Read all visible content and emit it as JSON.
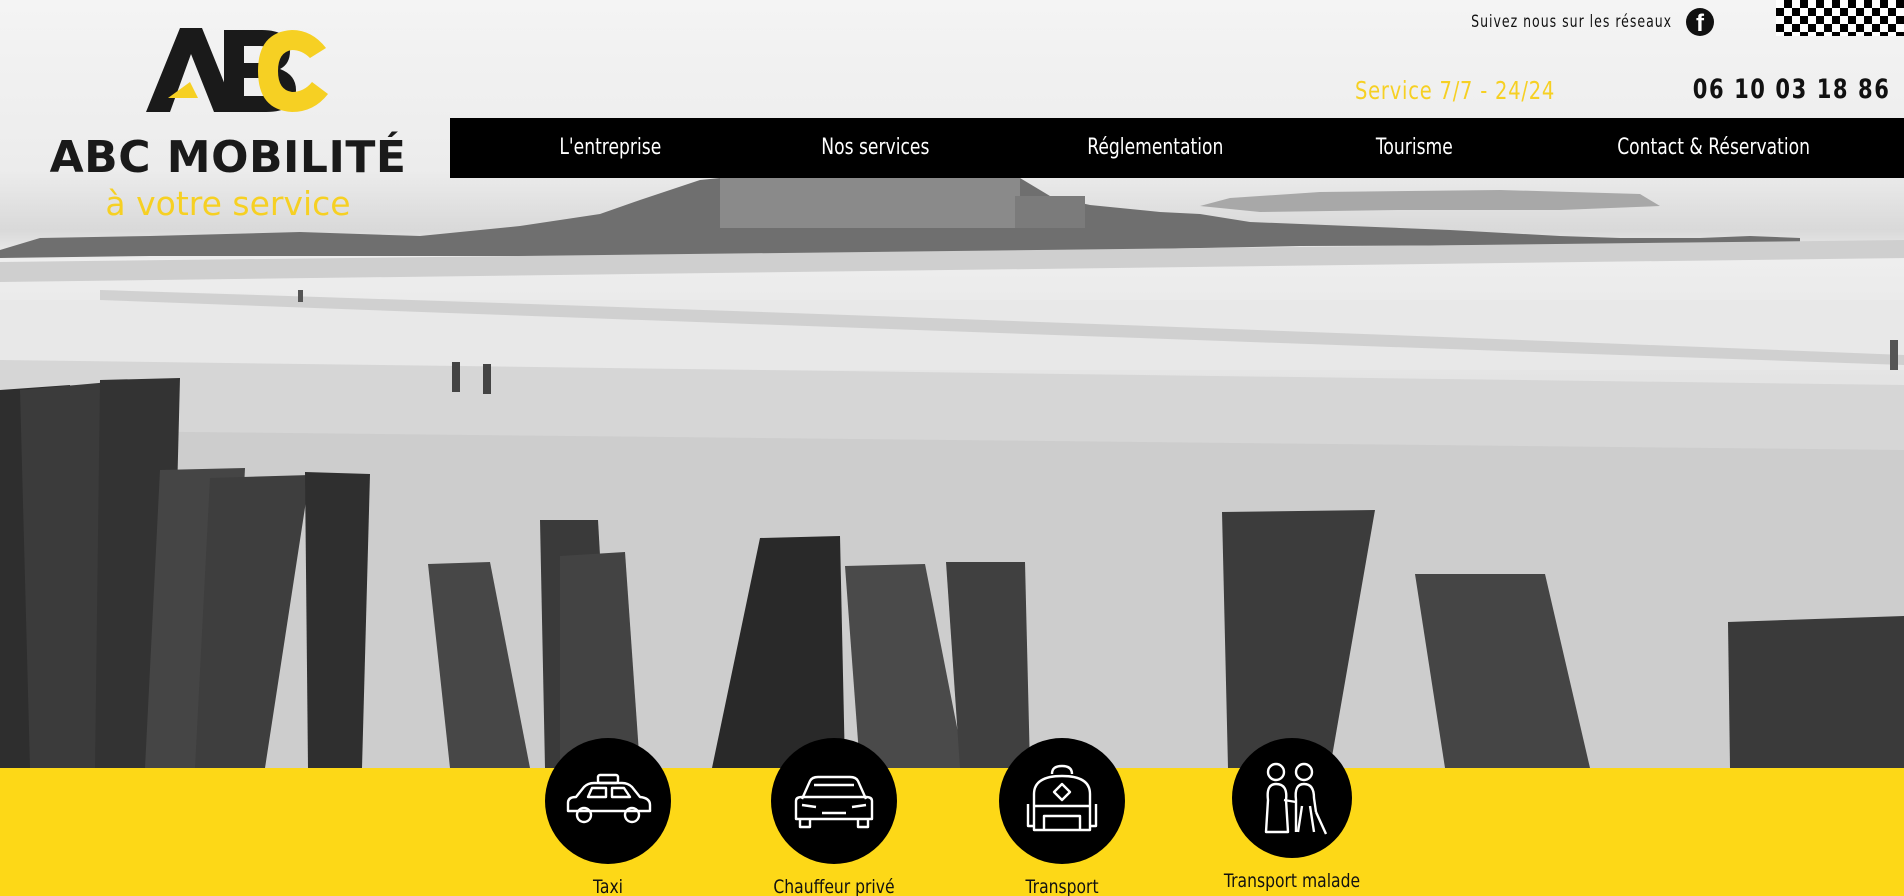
{
  "brand": {
    "logo_letters": "ABC",
    "name": "ABC MOBILITÉ",
    "tagline": "à votre service",
    "colors": {
      "accent": "#fdd817",
      "dark": "#111111"
    }
  },
  "topbar": {
    "social_text": "Suivez nous sur les réseaux",
    "social_icon": "facebook-icon",
    "service_hours": "Service 7/7 - 24/24",
    "phone": "06 10 03 18 86"
  },
  "nav": {
    "items": [
      {
        "label": "L'entreprise"
      },
      {
        "label": "Nos services"
      },
      {
        "label": "Réglementation"
      },
      {
        "label": "Tourisme"
      },
      {
        "label": "Contact & Réservation"
      }
    ]
  },
  "services": [
    {
      "label": "Taxi",
      "icon": "taxi-icon"
    },
    {
      "label": "Chauffeur privé",
      "icon": "car-icon"
    },
    {
      "label": "Transport",
      "icon": "backpack-icon"
    },
    {
      "label": "Transport malade",
      "icon": "elderly-people-icon"
    }
  ]
}
